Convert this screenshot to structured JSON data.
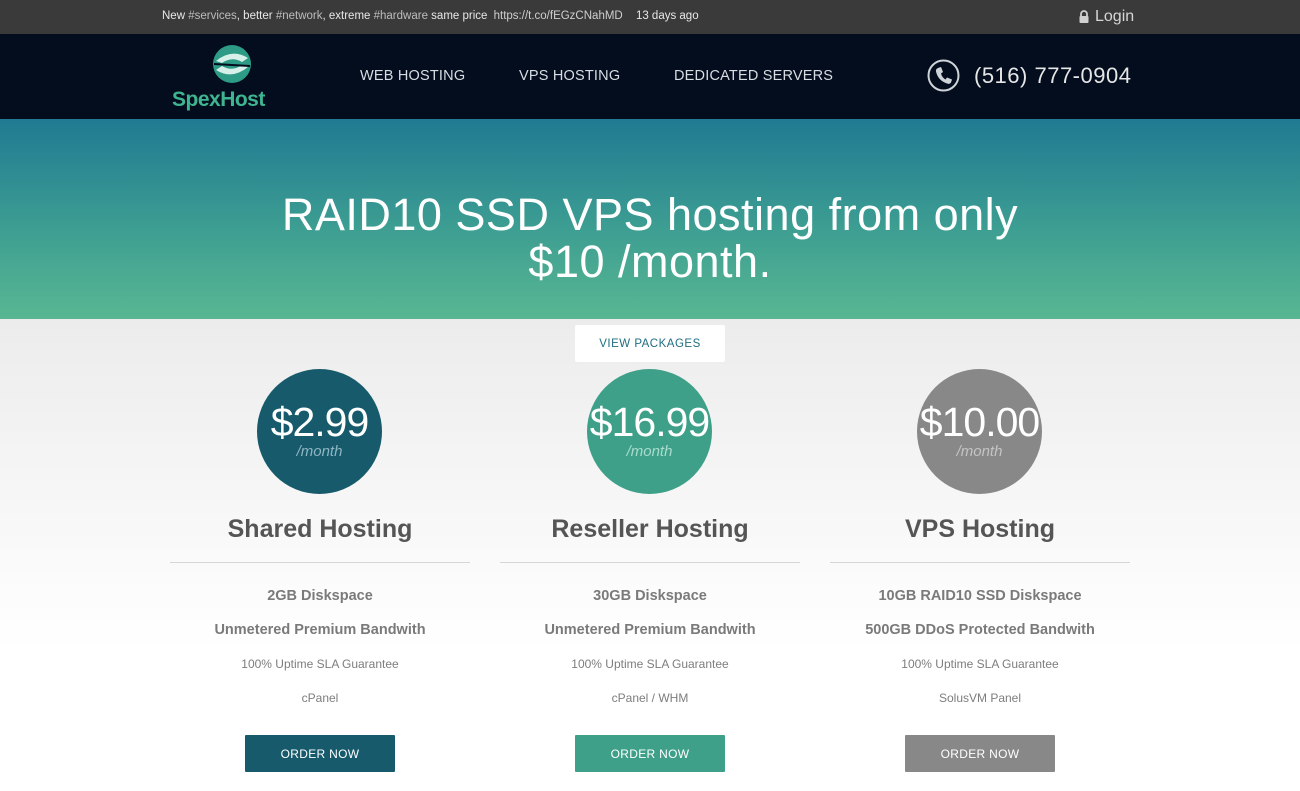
{
  "topbar": {
    "tweet": {
      "w1": "New",
      "t1": "#services",
      "w2": ", better",
      "t2": "#network",
      "w3": ", extreme",
      "t3": "#hardware",
      "w4": "same price",
      "link": "https://t.co/fEGzCNahMD",
      "ago": "13 days ago"
    },
    "login_label": "Login"
  },
  "nav": {
    "logo_text": "SpexHost",
    "menu": [
      "WEB HOSTING",
      "VPS HOSTING",
      "DEDICATED SERVERS"
    ],
    "phone": "(516) 777-0904"
  },
  "hero": {
    "line1": "RAID10 SSD VPS hosting from only",
    "line2": "$10 /month."
  },
  "view_packages_label": "VIEW PACKAGES",
  "colors": {
    "shared": "#165a6c",
    "reseller": "#3fa08a",
    "vps": "#888888"
  },
  "plans": [
    {
      "price": "$2.99",
      "per": "/month",
      "title": "Shared Hosting",
      "features": [
        "2GB Diskspace",
        "Unmetered Premium Bandwith",
        "100% Uptime SLA Guarantee",
        "cPanel"
      ],
      "order_label": "ORDER NOW"
    },
    {
      "price": "$16.99",
      "per": "/month",
      "title": "Reseller Hosting",
      "features": [
        "30GB Diskspace",
        "Unmetered Premium Bandwith",
        "100% Uptime SLA Guarantee",
        "cPanel / WHM"
      ],
      "order_label": "ORDER NOW"
    },
    {
      "price": "$10.00",
      "per": "/month",
      "title": "VPS Hosting",
      "features": [
        "10GB RAID10 SSD Diskspace",
        "500GB DDoS Protected Bandwith",
        "100% Uptime SLA Guarantee",
        "SolusVM Panel"
      ],
      "order_label": "ORDER NOW"
    }
  ]
}
